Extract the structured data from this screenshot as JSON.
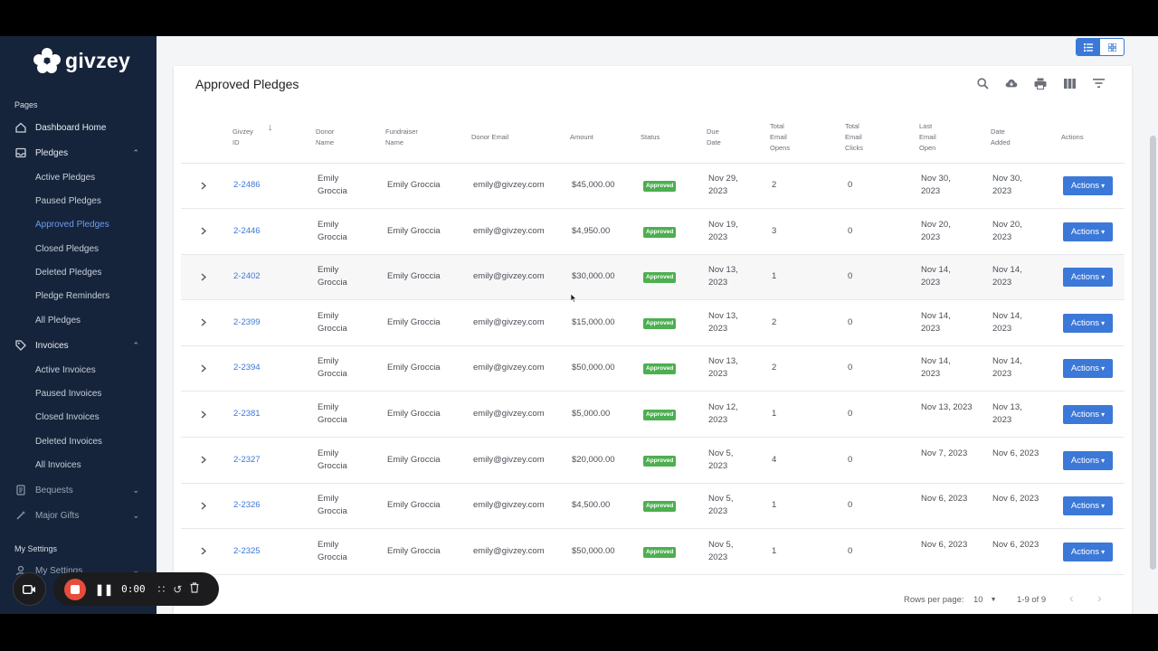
{
  "app": {
    "brand": "givzey"
  },
  "sidebar": {
    "section_pages": "Pages",
    "dashboard": "Dashboard Home",
    "pledges": "Pledges",
    "pledge_items": [
      "Active Pledges",
      "Paused Pledges",
      "Approved Pledges",
      "Closed Pledges",
      "Deleted Pledges",
      "Pledge Reminders",
      "All Pledges"
    ],
    "invoices": "Invoices",
    "invoice_items": [
      "Active Invoices",
      "Paused Invoices",
      "Closed Invoices",
      "Deleted Invoices",
      "All Invoices"
    ],
    "bequests": "Bequests",
    "major_gifts": "Major Gifts",
    "section_settings": "My Settings",
    "my_settings": "My Settings"
  },
  "recorder": {
    "time": "0:00"
  },
  "page": {
    "title": "Approved Pledges",
    "columns": [
      [
        "Givzey",
        "ID"
      ],
      [
        "Donor",
        "Name"
      ],
      [
        "Fundraiser",
        "Name"
      ],
      [
        "Donor Email"
      ],
      [
        "Amount"
      ],
      [
        "Status"
      ],
      [
        "Due",
        "Date"
      ],
      [
        "Total",
        "Email",
        "Opens"
      ],
      [
        "Total",
        "Email",
        "Clicks"
      ],
      [
        "Last",
        "Email",
        "Open"
      ],
      [
        "Date",
        "Added"
      ],
      [
        "Actions"
      ]
    ],
    "action_label": "Actions",
    "rows": [
      {
        "id": "2-2486",
        "donor": [
          "Emily",
          "Groccia"
        ],
        "fundraiser": "Emily Groccia",
        "email": "emily@givzey.com",
        "amount": "$45,000.00",
        "status": "Approved",
        "due": [
          "Nov 29,",
          "2023"
        ],
        "opens": "2",
        "clicks": "0",
        "last_open": [
          "Nov 30,",
          "2023"
        ],
        "added": [
          "Nov 30,",
          "2023"
        ]
      },
      {
        "id": "2-2446",
        "donor": [
          "Emily",
          "Groccia"
        ],
        "fundraiser": "Emily Groccia",
        "email": "emily@givzey.com",
        "amount": "$4,950.00",
        "status": "Approved",
        "due": [
          "Nov 19,",
          "2023"
        ],
        "opens": "3",
        "clicks": "0",
        "last_open": [
          "Nov 20,",
          "2023"
        ],
        "added": [
          "Nov 20,",
          "2023"
        ]
      },
      {
        "id": "2-2402",
        "donor": [
          "Emily",
          "Groccia"
        ],
        "fundraiser": "Emily Groccia",
        "email": "emily@givzey.com",
        "amount": "$30,000.00",
        "status": "Approved",
        "due": [
          "Nov 13,",
          "2023"
        ],
        "opens": "1",
        "clicks": "0",
        "last_open": [
          "Nov 14,",
          "2023"
        ],
        "added": [
          "Nov 14,",
          "2023"
        ]
      },
      {
        "id": "2-2399",
        "donor": [
          "Emily",
          "Groccia"
        ],
        "fundraiser": "Emily Groccia",
        "email": "emily@givzey.com",
        "amount": "$15,000.00",
        "status": "Approved",
        "due": [
          "Nov 13,",
          "2023"
        ],
        "opens": "2",
        "clicks": "0",
        "last_open": [
          "Nov 14,",
          "2023"
        ],
        "added": [
          "Nov 14,",
          "2023"
        ]
      },
      {
        "id": "2-2394",
        "donor": [
          "Emily",
          "Groccia"
        ],
        "fundraiser": "Emily Groccia",
        "email": "emily@givzey.com",
        "amount": "$50,000.00",
        "status": "Approved",
        "due": [
          "Nov 13,",
          "2023"
        ],
        "opens": "2",
        "clicks": "0",
        "last_open": [
          "Nov 14,",
          "2023"
        ],
        "added": [
          "Nov 14,",
          "2023"
        ]
      },
      {
        "id": "2-2381",
        "donor": [
          "Emily",
          "Groccia"
        ],
        "fundraiser": "Emily Groccia",
        "email": "emily@givzey.com",
        "amount": "$5,000.00",
        "status": "Approved",
        "due": [
          "Nov 12,",
          "2023"
        ],
        "opens": "1",
        "clicks": "0",
        "last_open": [
          "Nov 13, 2023",
          ""
        ],
        "added": [
          "Nov 13,",
          "2023"
        ]
      },
      {
        "id": "2-2327",
        "donor": [
          "Emily",
          "Groccia"
        ],
        "fundraiser": "Emily Groccia",
        "email": "emily@givzey.com",
        "amount": "$20,000.00",
        "status": "Approved",
        "due": [
          "Nov 5,",
          "2023"
        ],
        "opens": "4",
        "clicks": "0",
        "last_open": [
          "Nov 7, 2023",
          ""
        ],
        "added": [
          "Nov 6, 2023",
          ""
        ]
      },
      {
        "id": "2-2326",
        "donor": [
          "Emily",
          "Groccia"
        ],
        "fundraiser": "Emily Groccia",
        "email": "emily@givzey.com",
        "amount": "$4,500.00",
        "status": "Approved",
        "due": [
          "Nov 5,",
          "2023"
        ],
        "opens": "1",
        "clicks": "0",
        "last_open": [
          "Nov 6, 2023",
          ""
        ],
        "added": [
          "Nov 6, 2023",
          ""
        ]
      },
      {
        "id": "2-2325",
        "donor": [
          "Emily",
          "Groccia"
        ],
        "fundraiser": "Emily Groccia",
        "email": "emily@givzey.com",
        "amount": "$50,000.00",
        "status": "Approved",
        "due": [
          "Nov 5,",
          "2023"
        ],
        "opens": "1",
        "clicks": "0",
        "last_open": [
          "Nov 6, 2023",
          ""
        ],
        "added": [
          "Nov 6, 2023",
          ""
        ]
      }
    ],
    "footer": {
      "rows_per_page_label": "Rows per page:",
      "rows_per_page": "10",
      "range": "1-9 of 9"
    }
  },
  "colors": {
    "sidebar_bg": "#16243b",
    "accent": "#3b78d8",
    "approved": "#4caf50"
  }
}
